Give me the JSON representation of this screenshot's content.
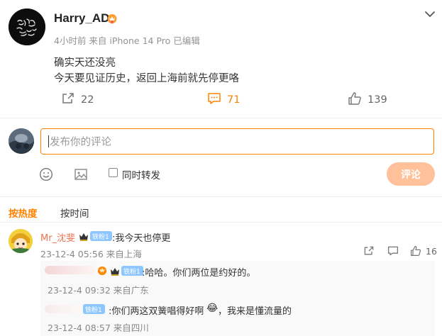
{
  "post": {
    "author": "Harry_AD",
    "meta": "4小时前  来自 iPhone 14 Pro 已编辑",
    "body_lines": [
      "确实天还没亮",
      "今天要见证历史，返回上海前就先停更咯"
    ],
    "repost_count": "22",
    "comment_count": "71",
    "like_count": "139"
  },
  "compose": {
    "placeholder": "发布你的评论",
    "repost_label": "同时转发",
    "submit_label": "评论"
  },
  "sort": {
    "hot": "按热度",
    "time": "按时间"
  },
  "comments": [
    {
      "author": "Mr_沈斐",
      "fan_badge": "铁粉1",
      "text": ":我今天也停更",
      "meta": "23-12-4 05:56 来自上海",
      "like_count": "16",
      "replies": [
        {
          "fan_badge": "铁粉1",
          "text": ":哈哈。你们两位是约好的。",
          "meta": "23-12-4 09:32 来自广东"
        },
        {
          "fan_badge": "铁粉1",
          "text": ":你们两这双簧唱得好啊",
          "emoji": "😂",
          "text_after": "，我来是懂流量的",
          "meta": "23-12-4 08:57 来自四川"
        }
      ]
    }
  ],
  "colors": {
    "accent": "#ff8200",
    "name_link": "#eb7350",
    "fan_badge": "#8ec7ff",
    "submit_disabled": "#ffc09a"
  }
}
